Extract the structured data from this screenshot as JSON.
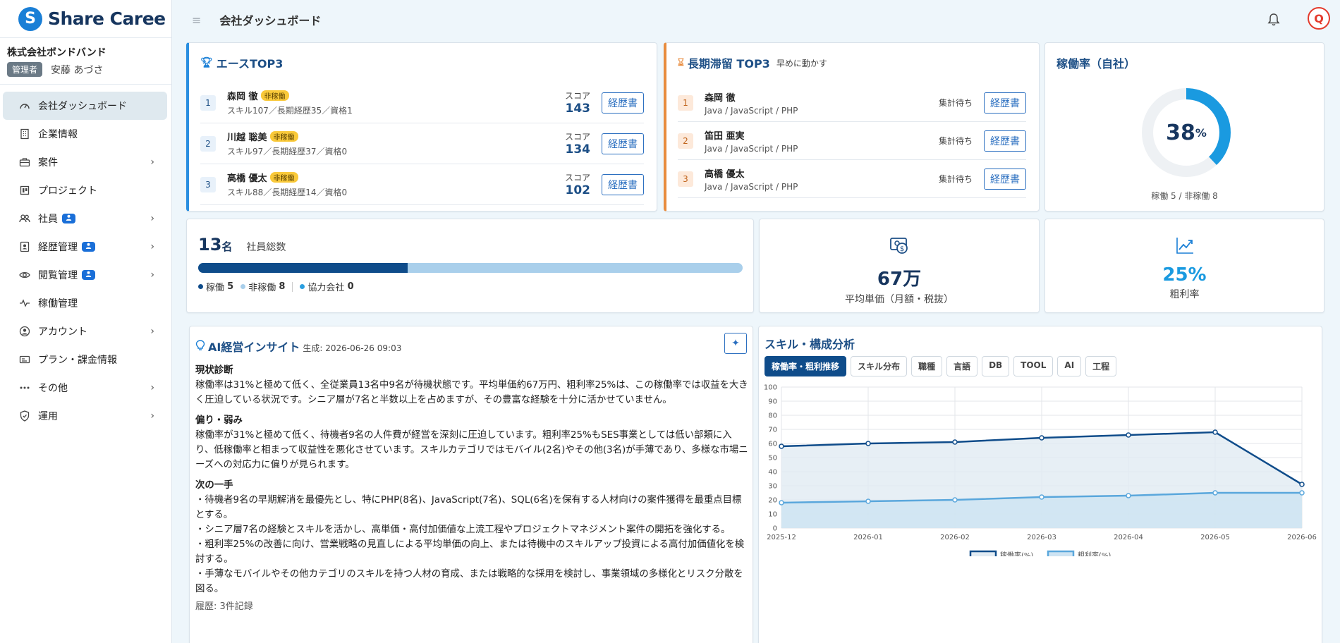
{
  "app": {
    "brand": "Share Caree",
    "logo_letter": "S"
  },
  "company": {
    "name": "株式会社ボンドバンド",
    "role": "管理者",
    "user_name": "安藤 あづさ"
  },
  "header": {
    "menu_icon": "≡",
    "title": "会社ダッシュボード",
    "avatar_text": "Q"
  },
  "nav": [
    {
      "label": "会社ダッシュボード",
      "icon": "gauge-icon",
      "active": true
    },
    {
      "label": "企業情報",
      "icon": "building-icon"
    },
    {
      "label": "案件",
      "icon": "briefcase-icon",
      "chevron": true
    },
    {
      "label": "プロジェクト",
      "icon": "project-icon"
    },
    {
      "label": "社員",
      "icon": "users-icon",
      "badge": true,
      "chevron": true
    },
    {
      "label": "経歴管理",
      "icon": "id-card-icon",
      "badge": true,
      "chevron": true
    },
    {
      "label": "閲覧管理",
      "icon": "eye-icon",
      "badge": true,
      "chevron": true
    },
    {
      "label": "稼働管理",
      "icon": "activity-icon"
    },
    {
      "label": "アカウント",
      "icon": "account-icon",
      "chevron": true
    },
    {
      "label": "プラン・課金情報",
      "icon": "billing-icon"
    },
    {
      "label": "その他",
      "icon": "more-icon",
      "chevron": true
    },
    {
      "label": "運用",
      "icon": "shield-icon",
      "chevron": true
    }
  ],
  "ace": {
    "title": "エースTOP3",
    "score_label": "スコア",
    "button_label": "経歴書",
    "items": [
      {
        "rank": "1",
        "name": "森岡 徹",
        "tag": "非稼働",
        "detail": "スキル107／長期経歴35／資格1",
        "score": "143"
      },
      {
        "rank": "2",
        "name": "川越 聡美",
        "tag": "非稼働",
        "detail": "スキル97／長期経歴37／資格0",
        "score": "134"
      },
      {
        "rank": "3",
        "name": "高橋 優太",
        "tag": "非稼働",
        "detail": "スキル88／長期経歴14／資格0",
        "score": "102"
      }
    ]
  },
  "stay": {
    "title": "長期滞留 TOP3",
    "note": "早めに動かす",
    "button_label": "経歴書",
    "items": [
      {
        "rank": "1",
        "name": "森岡 徹",
        "detail": "Java / JavaScript / PHP",
        "status": "集計待ち"
      },
      {
        "rank": "2",
        "name": "笛田 亜実",
        "detail": "Java / JavaScript / PHP",
        "status": "集計待ち"
      },
      {
        "rank": "3",
        "name": "高橋 優太",
        "detail": "Java / JavaScript / PHP",
        "status": "集計待ち"
      }
    ]
  },
  "util": {
    "title": "稼働率（自社）",
    "value": "38",
    "unit": "%",
    "percent": 38,
    "caption": "稼働 5 / 非稼働 8"
  },
  "employees": {
    "count": "13",
    "unit": "名",
    "label": "社員総数",
    "active_ratio": 0.3846,
    "legend": [
      {
        "label": "稼働",
        "value": "5",
        "color": "#0f4c8a"
      },
      {
        "label": "非稼働",
        "value": "8",
        "color": "#a9cfeb"
      },
      {
        "label": "協力会社",
        "value": "0",
        "color": "#2b9fe0"
      }
    ]
  },
  "price": {
    "value": "67万",
    "label": "平均単価（月額・税抜）"
  },
  "gross": {
    "value": "25%",
    "label": "粗利率"
  },
  "ai": {
    "title": "AI経営インサイト",
    "generated": "生成: 2026-06-26 09:03",
    "sections": [
      {
        "title": "現状診断",
        "lines": [
          "稼働率は31%と極めて低く、全従業員13名中9名が待機状態です。平均単価約67万円、粗利率25%は、この稼働率では収益を大きく圧迫している状況です。シニア層が7名と半数以上を占めますが、その豊富な経験を十分に活かせていません。"
        ]
      },
      {
        "title": "偏り・弱み",
        "lines": [
          "稼働率が31%と極めて低く、待機者9名の人件費が経営を深刻に圧迫しています。粗利率25%もSES事業としては低い部類に入り、低稼働率と相まって収益性を悪化させています。スキルカテゴリではモバイル(2名)やその他(3名)が手薄であり、多様な市場ニーズへの対応力に偏りが見られます。"
        ]
      },
      {
        "title": "次の一手",
        "lines": [
          "・待機者9名の早期解消を最優先とし、特にPHP(8名)、JavaScript(7名)、SQL(6名)を保有する人材向けの案件獲得を最重点目標とする。",
          "・シニア層7名の経験とスキルを活かし、高単価・高付加価値な上流工程やプロジェクトマネジメント案件の開拓を強化する。",
          "・粗利率25%の改善に向け、営業戦略の見直しによる平均単価の向上、または待機中のスキルアップ投資による高付加価値化を検討する。",
          "・手薄なモバイルやその他カテゴリのスキルを持つ人材の育成、または戦略的な採用を検討し、事業領域の多様化とリスク分散を図る。"
        ]
      }
    ],
    "history": "履歴: 3件記録"
  },
  "skill": {
    "title": "スキル・構成分析",
    "tabs": [
      {
        "label": "稼働率・粗利推移",
        "active": true
      },
      {
        "label": "スキル分布"
      },
      {
        "label": "職種"
      },
      {
        "label": "言語"
      },
      {
        "label": "DB"
      },
      {
        "label": "TOOL"
      },
      {
        "label": "AI"
      },
      {
        "label": "工程"
      }
    ]
  },
  "chart_data": {
    "type": "line",
    "x": [
      "2025-12",
      "2026-01",
      "2026-02",
      "2026-03",
      "2026-04",
      "2026-05",
      "2026-06"
    ],
    "ylim": [
      0,
      100
    ],
    "yticks": [
      0,
      10,
      20,
      30,
      40,
      50,
      60,
      70,
      80,
      90,
      100
    ],
    "grid": true,
    "legend_position": "bottom",
    "series": [
      {
        "name": "稼働率(%)",
        "values": [
          58,
          60,
          61,
          64,
          66,
          68,
          31
        ],
        "color": "#0f4c8a",
        "fill": "#e1ebf3"
      },
      {
        "name": "粗利率(%)",
        "values": [
          18,
          19,
          20,
          22,
          23,
          25,
          25
        ],
        "color": "#5aa7dc",
        "fill": "#cde3f3"
      }
    ]
  }
}
